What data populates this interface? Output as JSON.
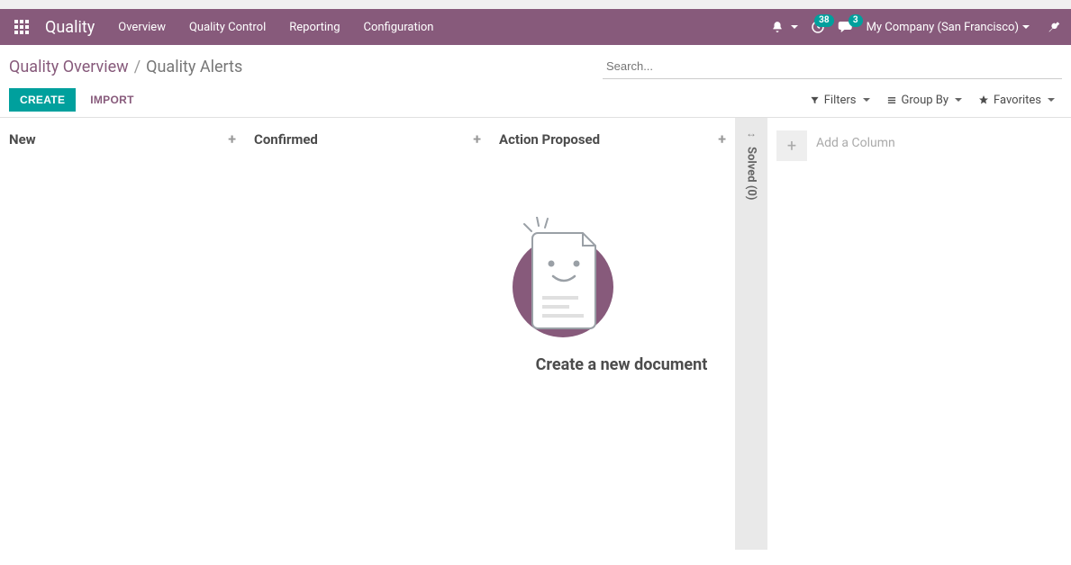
{
  "navbar": {
    "app_title": "Quality",
    "menu": [
      "Overview",
      "Quality Control",
      "Reporting",
      "Configuration"
    ],
    "activities_count": "38",
    "messages_count": "3",
    "company": "My Company (San Francisco)"
  },
  "breadcrumb": {
    "parent": "Quality Overview",
    "current": "Quality Alerts"
  },
  "search": {
    "placeholder": "Search..."
  },
  "buttons": {
    "create": "CREATE",
    "import": "IMPORT"
  },
  "filters": {
    "filters": "Filters",
    "group_by": "Group By",
    "favorites": "Favorites"
  },
  "kanban": {
    "columns": [
      "New",
      "Confirmed",
      "Action Proposed"
    ],
    "folded": {
      "label": "Solved",
      "count": "(0)"
    },
    "add_column": "Add a Column"
  },
  "empty_state": {
    "title": "Create a new document"
  }
}
